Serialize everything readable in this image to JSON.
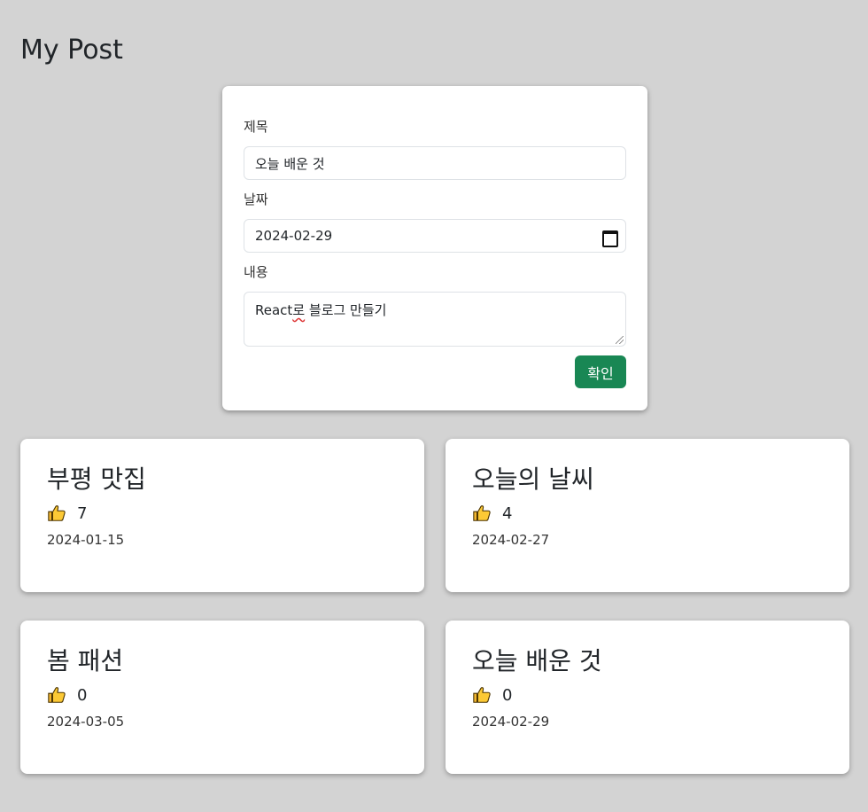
{
  "page": {
    "title": "My Post"
  },
  "form": {
    "title_label": "제목",
    "title_value": "오늘 배운 것",
    "date_label": "날짜",
    "date_value": "2024-02-29",
    "content_label": "내용",
    "content_value_prefix": "React",
    "content_value_squiggle": "로",
    "content_value_suffix": " 블로그 만들기",
    "submit_label": "확인",
    "submit_color": "#198754"
  },
  "posts": [
    {
      "title": "부평 맛집",
      "likes": "7",
      "date": "2024-01-15",
      "like_icon": "thumbs-up-icon"
    },
    {
      "title": "오늘의 날씨",
      "likes": "4",
      "date": "2024-02-27",
      "like_icon": "thumbs-up-icon"
    },
    {
      "title": "봄 패션",
      "likes": "0",
      "date": "2024-03-05",
      "like_icon": "thumbs-up-icon"
    },
    {
      "title": "오늘 배운 것",
      "likes": "0",
      "date": "2024-02-29",
      "like_icon": "thumbs-up-icon"
    }
  ]
}
